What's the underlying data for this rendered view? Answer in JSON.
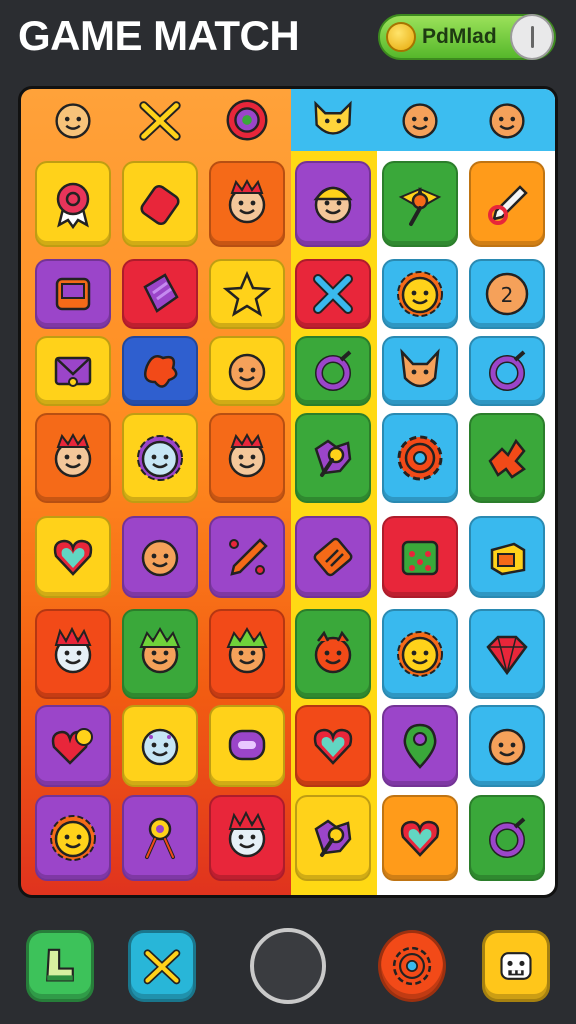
{
  "header": {
    "title": "GAME MATCH",
    "status_pill": {
      "label": "PdMlad",
      "icon": "coin-icon",
      "toggle_icon": "toggle-icon"
    }
  },
  "board": {
    "top_row": [
      {
        "icon": "smiley-badge-icon",
        "color": "#2fa8e8"
      },
      {
        "icon": "crossed-swords-icon",
        "color": "#f5b520"
      },
      {
        "icon": "spiral-gear-icon",
        "color": "#d94b7a"
      },
      {
        "icon": "cat-face-icon",
        "color": "#ffd43b"
      },
      {
        "icon": "face-icon",
        "color": "#f5a15a"
      },
      {
        "icon": "face-icon",
        "color": "#f5a15a"
      }
    ],
    "tiles": [
      [
        "ribbon-badge-icon",
        "gem-tag-icon",
        "crowned-face-icon",
        "helmet-face-icon",
        "winged-key-icon",
        "pencil-icon"
      ],
      [
        "tablet-icon",
        "crystal-icon",
        "star-icon",
        "cross-icon",
        "sun-face-icon",
        "coin-face-icon"
      ],
      [
        "envelope-icon",
        "splat-icon",
        "face-icon",
        "ring-icon",
        "fox-face-icon",
        "ring-icon"
      ],
      [
        "crowned-face-icon",
        "flower-face-icon",
        "crowned-face-icon",
        "puzzle-key-icon",
        "gear-icon",
        "puzzle-icon"
      ],
      [
        "heart-icon",
        "face-icon",
        "pen-icon",
        "bars-icon",
        "calendar-icon",
        "box-icon"
      ],
      [
        "spiky-face-icon",
        "leaf-face-icon",
        "leaf-face-icon",
        "monster-face-icon",
        "sun-face-icon",
        "gem-icon"
      ],
      [
        "hearts-icon",
        "dotted-face-icon",
        "chat-icon",
        "heart-icon",
        "location-pin-icon",
        "face-icon"
      ],
      [
        "sun-face-icon",
        "key-icon",
        "spiky-face-icon",
        "",
        "puzzle-key-icon",
        "heart-icon",
        "ring-icon"
      ]
    ],
    "tile_colors": [
      [
        "#ffd21a",
        "#ffd21a",
        "#f56a18",
        "#9b45c9",
        "#3aa83a",
        "#ff9b1a"
      ],
      [
        "#9b45c9",
        "#e8263a",
        "#ffd21a",
        "#e8263a",
        "#39b9ee",
        "#39b9ee"
      ],
      [
        "#ffd21a",
        "#2f5fcf",
        "#ffd21a",
        "#3aa83a",
        "#39b9ee",
        "#39b9ee"
      ],
      [
        "#f56a18",
        "#ffd21a",
        "#f56a18",
        "#3aa83a",
        "#39b9ee",
        "#3aa83a"
      ],
      [
        "#ffd21a",
        "#9b45c9",
        "#9b45c9",
        "#9b45c9",
        "#e8263a",
        "#39b9ee"
      ],
      [
        "#f24a18",
        "#3aa83a",
        "#f24a18",
        "#3aa83a",
        "#39b9ee",
        "#39b9ee"
      ],
      [
        "#9b45c9",
        "#ffd21a",
        "#ffd21a",
        "#f24a18",
        "#9b45c9",
        "#39b9ee"
      ],
      [
        "#9b45c9",
        "#9b45c9",
        "#e8263a",
        "#ffd21a",
        "#ff9b1a",
        "#3aa83a"
      ]
    ]
  },
  "toolbar": {
    "buttons": [
      {
        "icon": "boot-icon",
        "color": "#3dc25a"
      },
      {
        "icon": "crossed-swords-icon",
        "color": "#28b6d8"
      },
      {
        "icon": "reset-icon",
        "color": "#3a3c40"
      },
      {
        "icon": "gear-icon",
        "color": "#f24a18"
      },
      {
        "icon": "robot-face-icon",
        "color": "#ffc61a"
      }
    ]
  }
}
